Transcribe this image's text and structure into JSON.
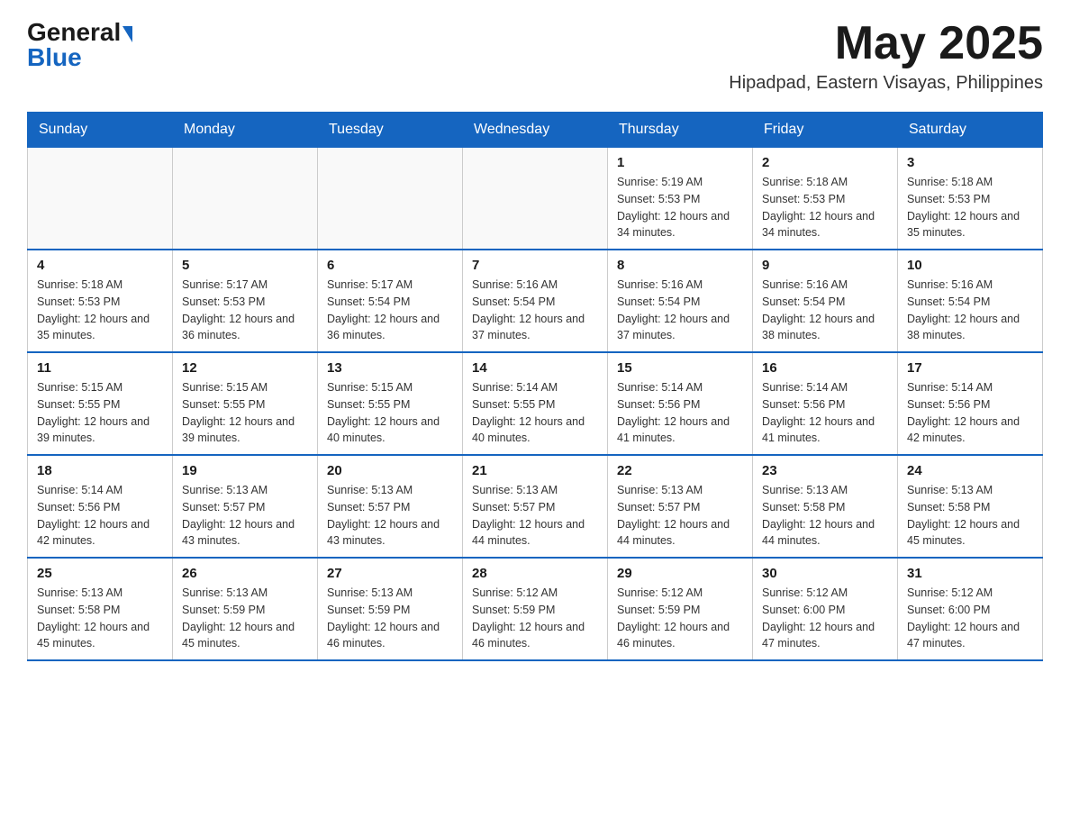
{
  "header": {
    "logo_general": "General",
    "logo_blue": "Blue",
    "month_title": "May 2025",
    "location": "Hipadpad, Eastern Visayas, Philippines"
  },
  "weekdays": [
    "Sunday",
    "Monday",
    "Tuesday",
    "Wednesday",
    "Thursday",
    "Friday",
    "Saturday"
  ],
  "weeks": [
    {
      "days": [
        {
          "num": "",
          "info": ""
        },
        {
          "num": "",
          "info": ""
        },
        {
          "num": "",
          "info": ""
        },
        {
          "num": "",
          "info": ""
        },
        {
          "num": "1",
          "info": "Sunrise: 5:19 AM\nSunset: 5:53 PM\nDaylight: 12 hours and 34 minutes."
        },
        {
          "num": "2",
          "info": "Sunrise: 5:18 AM\nSunset: 5:53 PM\nDaylight: 12 hours and 34 minutes."
        },
        {
          "num": "3",
          "info": "Sunrise: 5:18 AM\nSunset: 5:53 PM\nDaylight: 12 hours and 35 minutes."
        }
      ]
    },
    {
      "days": [
        {
          "num": "4",
          "info": "Sunrise: 5:18 AM\nSunset: 5:53 PM\nDaylight: 12 hours and 35 minutes."
        },
        {
          "num": "5",
          "info": "Sunrise: 5:17 AM\nSunset: 5:53 PM\nDaylight: 12 hours and 36 minutes."
        },
        {
          "num": "6",
          "info": "Sunrise: 5:17 AM\nSunset: 5:54 PM\nDaylight: 12 hours and 36 minutes."
        },
        {
          "num": "7",
          "info": "Sunrise: 5:16 AM\nSunset: 5:54 PM\nDaylight: 12 hours and 37 minutes."
        },
        {
          "num": "8",
          "info": "Sunrise: 5:16 AM\nSunset: 5:54 PM\nDaylight: 12 hours and 37 minutes."
        },
        {
          "num": "9",
          "info": "Sunrise: 5:16 AM\nSunset: 5:54 PM\nDaylight: 12 hours and 38 minutes."
        },
        {
          "num": "10",
          "info": "Sunrise: 5:16 AM\nSunset: 5:54 PM\nDaylight: 12 hours and 38 minutes."
        }
      ]
    },
    {
      "days": [
        {
          "num": "11",
          "info": "Sunrise: 5:15 AM\nSunset: 5:55 PM\nDaylight: 12 hours and 39 minutes."
        },
        {
          "num": "12",
          "info": "Sunrise: 5:15 AM\nSunset: 5:55 PM\nDaylight: 12 hours and 39 minutes."
        },
        {
          "num": "13",
          "info": "Sunrise: 5:15 AM\nSunset: 5:55 PM\nDaylight: 12 hours and 40 minutes."
        },
        {
          "num": "14",
          "info": "Sunrise: 5:14 AM\nSunset: 5:55 PM\nDaylight: 12 hours and 40 minutes."
        },
        {
          "num": "15",
          "info": "Sunrise: 5:14 AM\nSunset: 5:56 PM\nDaylight: 12 hours and 41 minutes."
        },
        {
          "num": "16",
          "info": "Sunrise: 5:14 AM\nSunset: 5:56 PM\nDaylight: 12 hours and 41 minutes."
        },
        {
          "num": "17",
          "info": "Sunrise: 5:14 AM\nSunset: 5:56 PM\nDaylight: 12 hours and 42 minutes."
        }
      ]
    },
    {
      "days": [
        {
          "num": "18",
          "info": "Sunrise: 5:14 AM\nSunset: 5:56 PM\nDaylight: 12 hours and 42 minutes."
        },
        {
          "num": "19",
          "info": "Sunrise: 5:13 AM\nSunset: 5:57 PM\nDaylight: 12 hours and 43 minutes."
        },
        {
          "num": "20",
          "info": "Sunrise: 5:13 AM\nSunset: 5:57 PM\nDaylight: 12 hours and 43 minutes."
        },
        {
          "num": "21",
          "info": "Sunrise: 5:13 AM\nSunset: 5:57 PM\nDaylight: 12 hours and 44 minutes."
        },
        {
          "num": "22",
          "info": "Sunrise: 5:13 AM\nSunset: 5:57 PM\nDaylight: 12 hours and 44 minutes."
        },
        {
          "num": "23",
          "info": "Sunrise: 5:13 AM\nSunset: 5:58 PM\nDaylight: 12 hours and 44 minutes."
        },
        {
          "num": "24",
          "info": "Sunrise: 5:13 AM\nSunset: 5:58 PM\nDaylight: 12 hours and 45 minutes."
        }
      ]
    },
    {
      "days": [
        {
          "num": "25",
          "info": "Sunrise: 5:13 AM\nSunset: 5:58 PM\nDaylight: 12 hours and 45 minutes."
        },
        {
          "num": "26",
          "info": "Sunrise: 5:13 AM\nSunset: 5:59 PM\nDaylight: 12 hours and 45 minutes."
        },
        {
          "num": "27",
          "info": "Sunrise: 5:13 AM\nSunset: 5:59 PM\nDaylight: 12 hours and 46 minutes."
        },
        {
          "num": "28",
          "info": "Sunrise: 5:12 AM\nSunset: 5:59 PM\nDaylight: 12 hours and 46 minutes."
        },
        {
          "num": "29",
          "info": "Sunrise: 5:12 AM\nSunset: 5:59 PM\nDaylight: 12 hours and 46 minutes."
        },
        {
          "num": "30",
          "info": "Sunrise: 5:12 AM\nSunset: 6:00 PM\nDaylight: 12 hours and 47 minutes."
        },
        {
          "num": "31",
          "info": "Sunrise: 5:12 AM\nSunset: 6:00 PM\nDaylight: 12 hours and 47 minutes."
        }
      ]
    }
  ]
}
